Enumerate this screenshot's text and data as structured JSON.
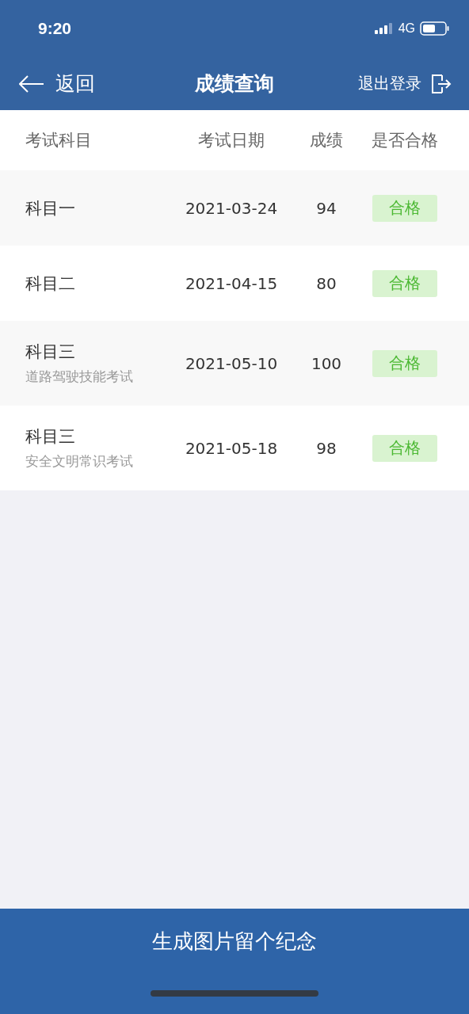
{
  "status_bar": {
    "time": "9:20",
    "network": "4G"
  },
  "nav": {
    "back": "返回",
    "title": "成绩查询",
    "logout": "退出登录"
  },
  "table": {
    "columns": [
      "考试科目",
      "考试日期",
      "成绩",
      "是否合格"
    ],
    "rows": [
      {
        "subject": "科目一",
        "date": "2021-03-24",
        "score": "94",
        "result": "合格",
        "passed": true
      },
      {
        "subject": "科目二",
        "date": "2021-04-15",
        "score": "80",
        "result": "合格",
        "passed": true
      },
      {
        "subject": "科目三",
        "note": "道路驾驶技能考试",
        "date": "2021-05-10",
        "score": "100",
        "result": "合格",
        "passed": true
      },
      {
        "subject": "科目三",
        "note": "安全文明常识考试",
        "date": "2021-05-18",
        "score": "98",
        "result": "合格",
        "passed": true
      }
    ]
  },
  "bottom_button": "生成图片留个纪念"
}
